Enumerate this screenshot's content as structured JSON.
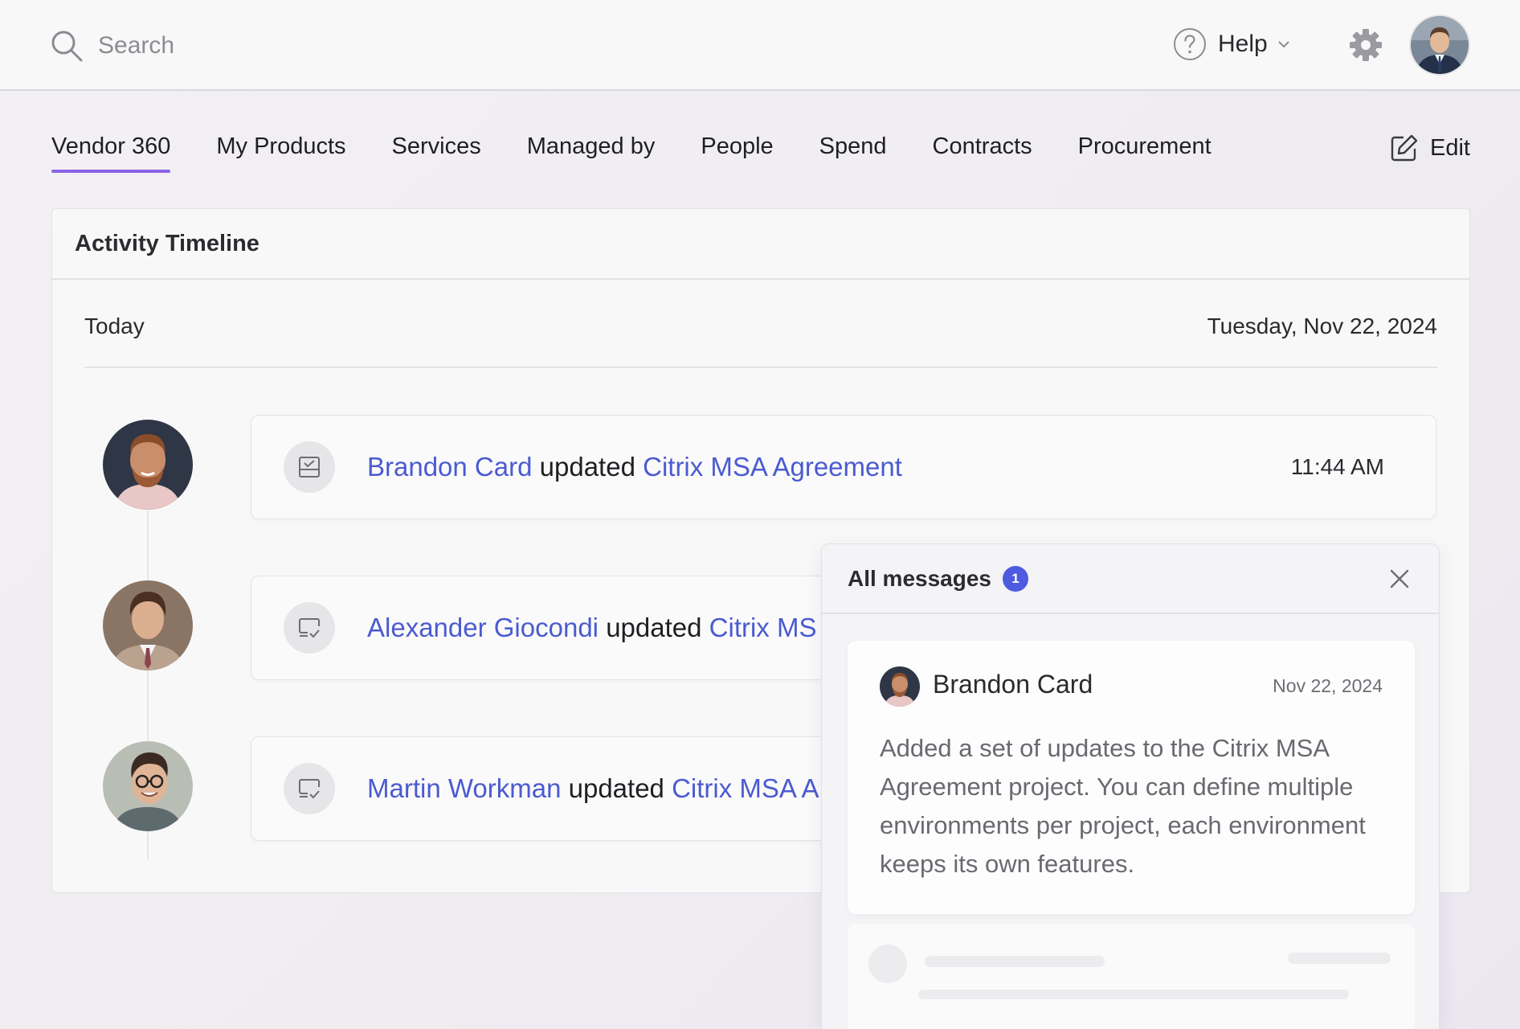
{
  "topbar": {
    "search_placeholder": "Search",
    "help_label": "Help",
    "icons": {
      "search": "search-icon",
      "help": "question-circle-icon",
      "settings": "gear-icon"
    }
  },
  "tabs": [
    {
      "label": "Vendor 360",
      "active": true
    },
    {
      "label": "My Products"
    },
    {
      "label": "Services"
    },
    {
      "label": "Managed by"
    },
    {
      "label": "People"
    },
    {
      "label": "Spend"
    },
    {
      "label": "Contracts"
    },
    {
      "label": "Procurement"
    }
  ],
  "edit_label": "Edit",
  "timeline": {
    "title": "Activity Timeline",
    "day_label": "Today",
    "day_date": "Tuesday, Nov 22, 2024",
    "events": [
      {
        "user": "Brandon Card",
        "action": "updated",
        "target": "Citrix MSA Agreement",
        "time": "11:44 AM"
      },
      {
        "user": "Alexander Giocondi",
        "action": "updated",
        "target": "Citrix MS"
      },
      {
        "user": "Martin Workman",
        "action": "updated",
        "target": "Citrix MSA A"
      }
    ]
  },
  "messages": {
    "title": "All messages",
    "badge_count": "1",
    "item": {
      "author": "Brandon Card",
      "date": "Nov 22, 2024",
      "body": "Added a set of updates to the Citrix MSA Agreement project. You can define multiple environments per project, each environment keeps its own features."
    }
  },
  "colors": {
    "accent": "#8c63e6",
    "link": "#4a5bd0",
    "badge": "#4d5be0"
  }
}
